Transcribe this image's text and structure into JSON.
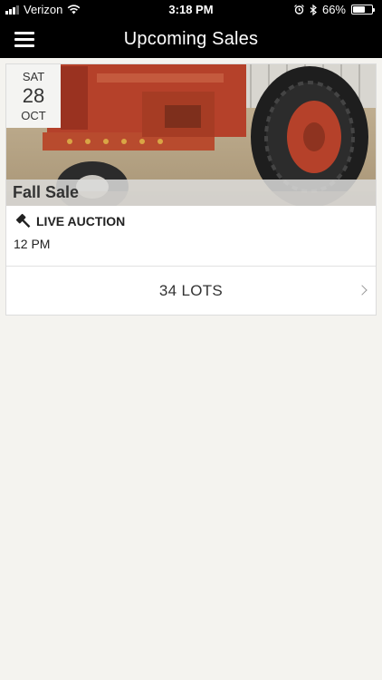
{
  "status": {
    "carrier": "Verizon",
    "time": "3:18 PM",
    "battery": "66%",
    "battery_level": 0.66
  },
  "nav": {
    "title": "Upcoming Sales"
  },
  "sale": {
    "date": {
      "dow": "SAT",
      "day": "28",
      "month": "OCT"
    },
    "title": "Fall Sale",
    "type": "LIVE AUCTION",
    "time": "12 PM",
    "lots": "34 LOTS"
  },
  "icons": {
    "menu": "hamburger-icon",
    "auction": "gavel-icon",
    "chevron": "chevron-right-icon",
    "alarm": "alarm-clock-icon",
    "bluetooth": "bluetooth-icon",
    "wifi": "wifi-icon"
  },
  "colors": {
    "nav_background": "#000000",
    "page_background": "#f4f3ef",
    "tractor_red": "#b5412a"
  }
}
